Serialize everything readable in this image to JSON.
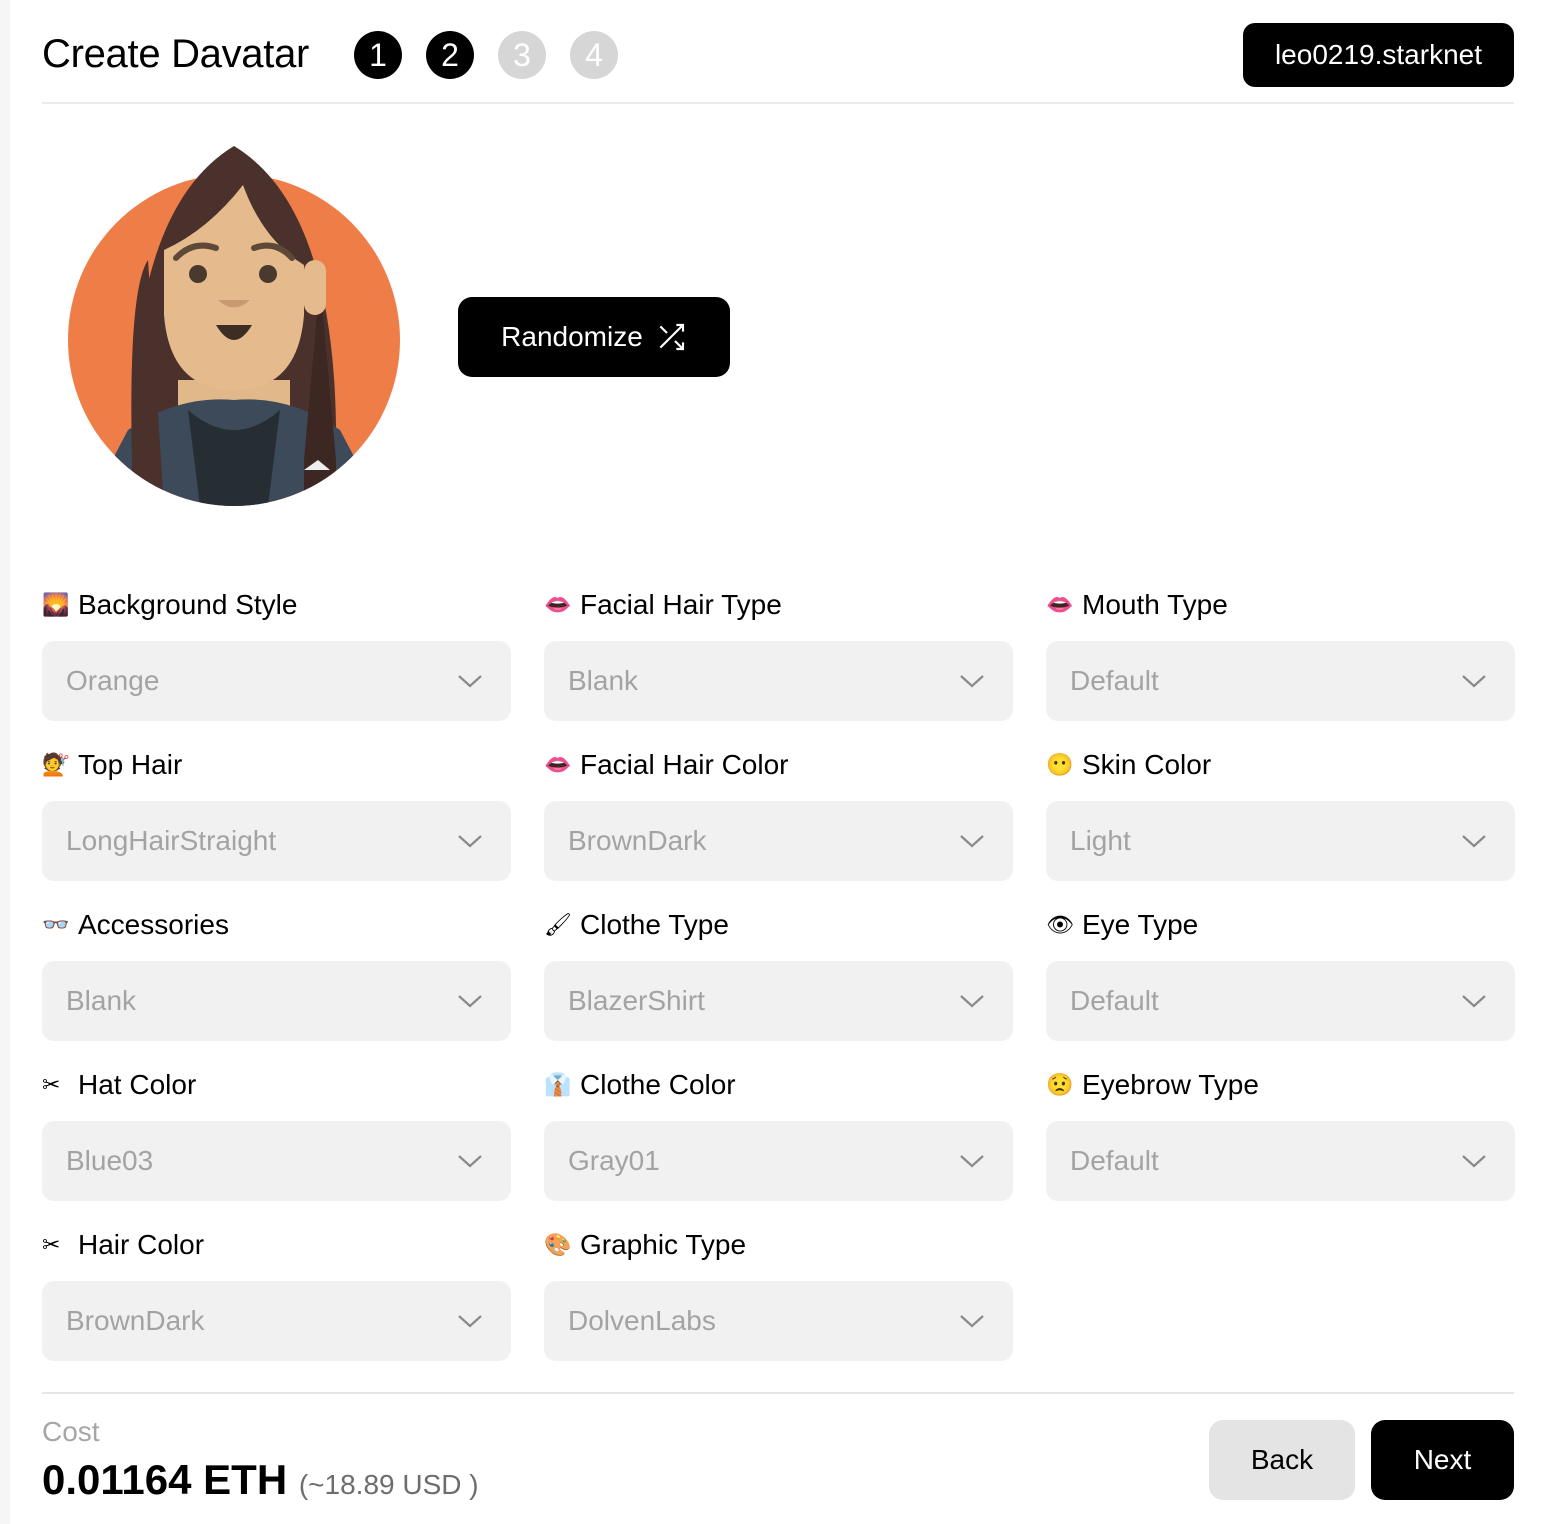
{
  "header": {
    "title": "Create Davatar",
    "steps": [
      {
        "label": "1",
        "active": true
      },
      {
        "label": "2",
        "active": true
      },
      {
        "label": "3",
        "active": false
      },
      {
        "label": "4",
        "active": false
      }
    ],
    "account": "leo0219.starknet"
  },
  "randomize": {
    "label": "Randomize",
    "icon": "shuffle-icon"
  },
  "colors": {
    "accent": "#000000",
    "avatar_bg": "#EF7D48",
    "select_bg": "#F1F1F1"
  },
  "fields": [
    {
      "label": "Background Style",
      "icon": "🌄",
      "value": "Orange"
    },
    {
      "label": "Facial Hair Type",
      "icon": "👄",
      "value": "Blank"
    },
    {
      "label": "Mouth Type",
      "icon": "👄",
      "value": "Default"
    },
    {
      "label": "Top Hair",
      "icon": "💇",
      "value": "LongHairStraight"
    },
    {
      "label": "Facial Hair Color",
      "icon": "👄",
      "value": "BrownDark"
    },
    {
      "label": "Skin Color",
      "icon": "😶",
      "value": "Light"
    },
    {
      "label": "Accessories",
      "icon": "👓",
      "value": "Blank"
    },
    {
      "label": "Clothe Type",
      "icon": "🖌",
      "value": "BlazerShirt"
    },
    {
      "label": "Eye Type",
      "icon": "👁",
      "value": "Default"
    },
    {
      "label": "Hat Color",
      "icon": "✂",
      "value": "Blue03"
    },
    {
      "label": "Clothe Color",
      "icon": "👔",
      "value": "Gray01"
    },
    {
      "label": "Eyebrow Type",
      "icon": "😟",
      "value": "Default"
    },
    {
      "label": "Hair Color",
      "icon": "✂",
      "value": "BrownDark"
    },
    {
      "label": "Graphic Type",
      "icon": "🎨",
      "value": "DolvenLabs"
    }
  ],
  "footer": {
    "cost_label": "Cost",
    "cost": "0.01164 ETH",
    "usd": "(~18.89 USD )",
    "back": "Back",
    "next": "Next"
  }
}
